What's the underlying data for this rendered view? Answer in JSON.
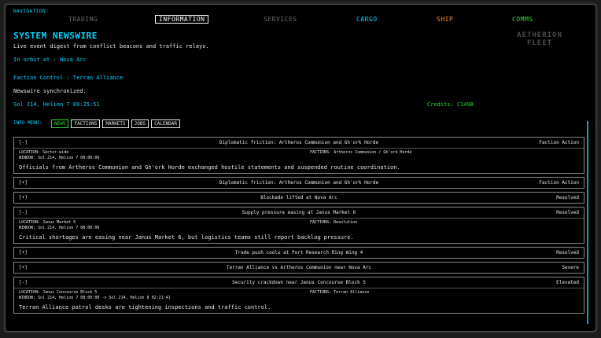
{
  "nav": {
    "label": "NAVIGATION:",
    "items": [
      "TRADING",
      "INFORMATION",
      "SERVICES",
      "CARGO",
      "SHIP",
      "COMMS"
    ]
  },
  "logo": {
    "line1": "AETHERION",
    "line2": "FLEET"
  },
  "header": {
    "title": "SYSTEM NEWSWIRE",
    "subtitle": "Live event digest from conflict beacons and traffic relays.",
    "orbit": "In orbit at : Nova Arc",
    "faction": "Faction Control : Terran Alliance",
    "status": "Newswire synchronized.",
    "time": "Sol 214, Helion 7 09:25:51",
    "credits": "Credits: C1498"
  },
  "menu": {
    "label": "INFO MENU:",
    "tabs": [
      "NEWS",
      "FACTIONS",
      "MARKETS",
      "JOBS",
      "CALENDAR"
    ]
  },
  "news": [
    {
      "toggle": "[-]",
      "title": "Diplomatic friction: Artheros Communion and Gh'ork Horde",
      "tag": "Faction Action",
      "location": "LOCATION: Sector-wide",
      "factions": "FACTIONS: Artheros Communion / Gh'ork Horde",
      "window": "WINDOW: Sol 214, Helion 7 08:00:00",
      "desc": "Officials from Artheros Communion and Gh'ork Horde exchanged hostile statements and suspended routine coordination."
    },
    {
      "toggle": "[+]",
      "title": "Diplomatic friction: Artheros Communion and Gh'ork Horde",
      "tag": "Faction Action"
    },
    {
      "toggle": "[+]",
      "title": "Blockade lifted at Nova Arc",
      "tag": "Resolved"
    },
    {
      "toggle": "[-]",
      "title": "Supply pressure easing at Janus Market 6",
      "tag": "Resolved",
      "location": "LOCATION: Janus Market 6",
      "factions": "FACTIONS: Resolution",
      "window": "WINDOW: Sol 214, Helion 7 08:00:00",
      "desc": "Critical shortages are easing near Janus Market 6, but logistics teams still report backlog pressure."
    },
    {
      "toggle": "[+]",
      "title": "Trade push cools at Port Research Ring Wing 4",
      "tag": "Resolved"
    },
    {
      "toggle": "[+]",
      "title": "Terran Alliance vs Artheros Communion near Nova Arc",
      "tag": "Severe"
    },
    {
      "toggle": "[-]",
      "title": "Security crackdown near Janus Concourse Block 5",
      "tag": "Elevated",
      "location": "LOCATION: Janus Concourse Block 5",
      "factions": "FACTIONS: Terran Alliance",
      "window": "WINDOW: Sol 214, Helion 7 08:00:00 -> Sol 214, Helion 8 02:21:41",
      "desc": "Terran Alliance patrol desks are tightening inspections and traffic control."
    }
  ],
  "colors": {
    "accent": "#00d8ff",
    "cargo": "#00d8ff",
    "ship": "#ff8c1a",
    "comms": "#2ddc2d",
    "credits": "#2ddc2d",
    "background": "#000000"
  }
}
